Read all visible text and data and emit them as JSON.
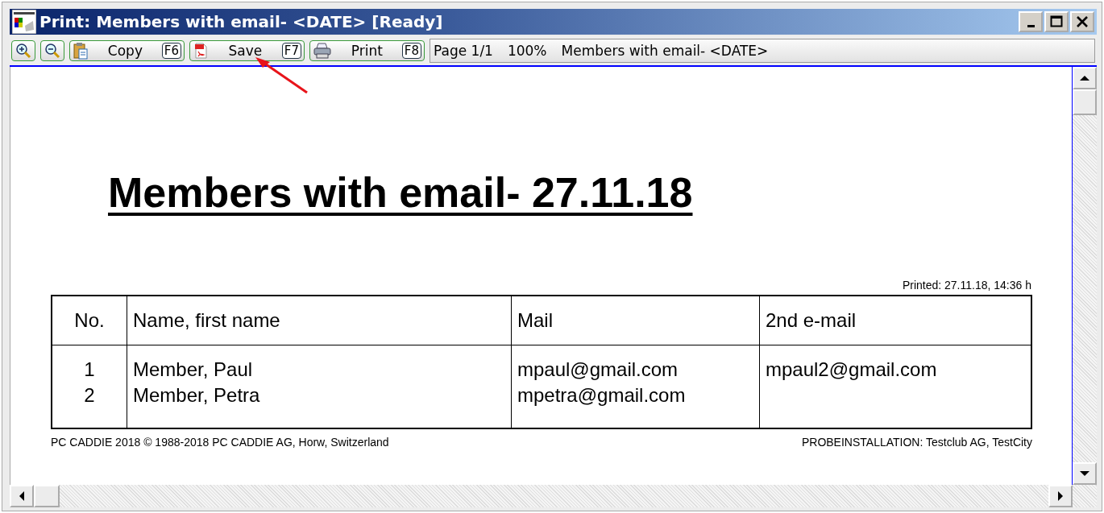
{
  "window": {
    "title": "Print: Members with email- <DATE> [Ready]"
  },
  "toolbar": {
    "buttons": [
      {
        "kind": "zoom-in"
      },
      {
        "kind": "zoom-out"
      },
      {
        "kind": "copy",
        "label": "Copy",
        "key": "F6"
      },
      {
        "kind": "save",
        "label": "Save",
        "key": "F7"
      },
      {
        "kind": "print",
        "label": "Print",
        "key": "F8"
      }
    ],
    "info": [
      "Page 1/1",
      "100%",
      "Members with email- <DATE>"
    ]
  },
  "document": {
    "title": "Members with email- 27.11.18",
    "printed": "Printed: 27.11.18, 14:36 h",
    "table": {
      "columns": [
        "No.",
        "Name, first name",
        "Mail",
        "2nd e-mail"
      ],
      "rows": [
        {
          "no": "1",
          "name": "Member, Paul",
          "mail": "mpaul@gmail.com",
          "email2": "mpaul2@gmail.com"
        },
        {
          "no": "2",
          "name": "Member, Petra",
          "mail": "mpetra@gmail.com"
        }
      ]
    },
    "footer_left": "PC CADDIE 2018  © 1988-2018 PC CADDIE AG, Horw, Switzerland",
    "footer_right": "PROBEINSTALLATION: Testclub AG, TestCity"
  }
}
